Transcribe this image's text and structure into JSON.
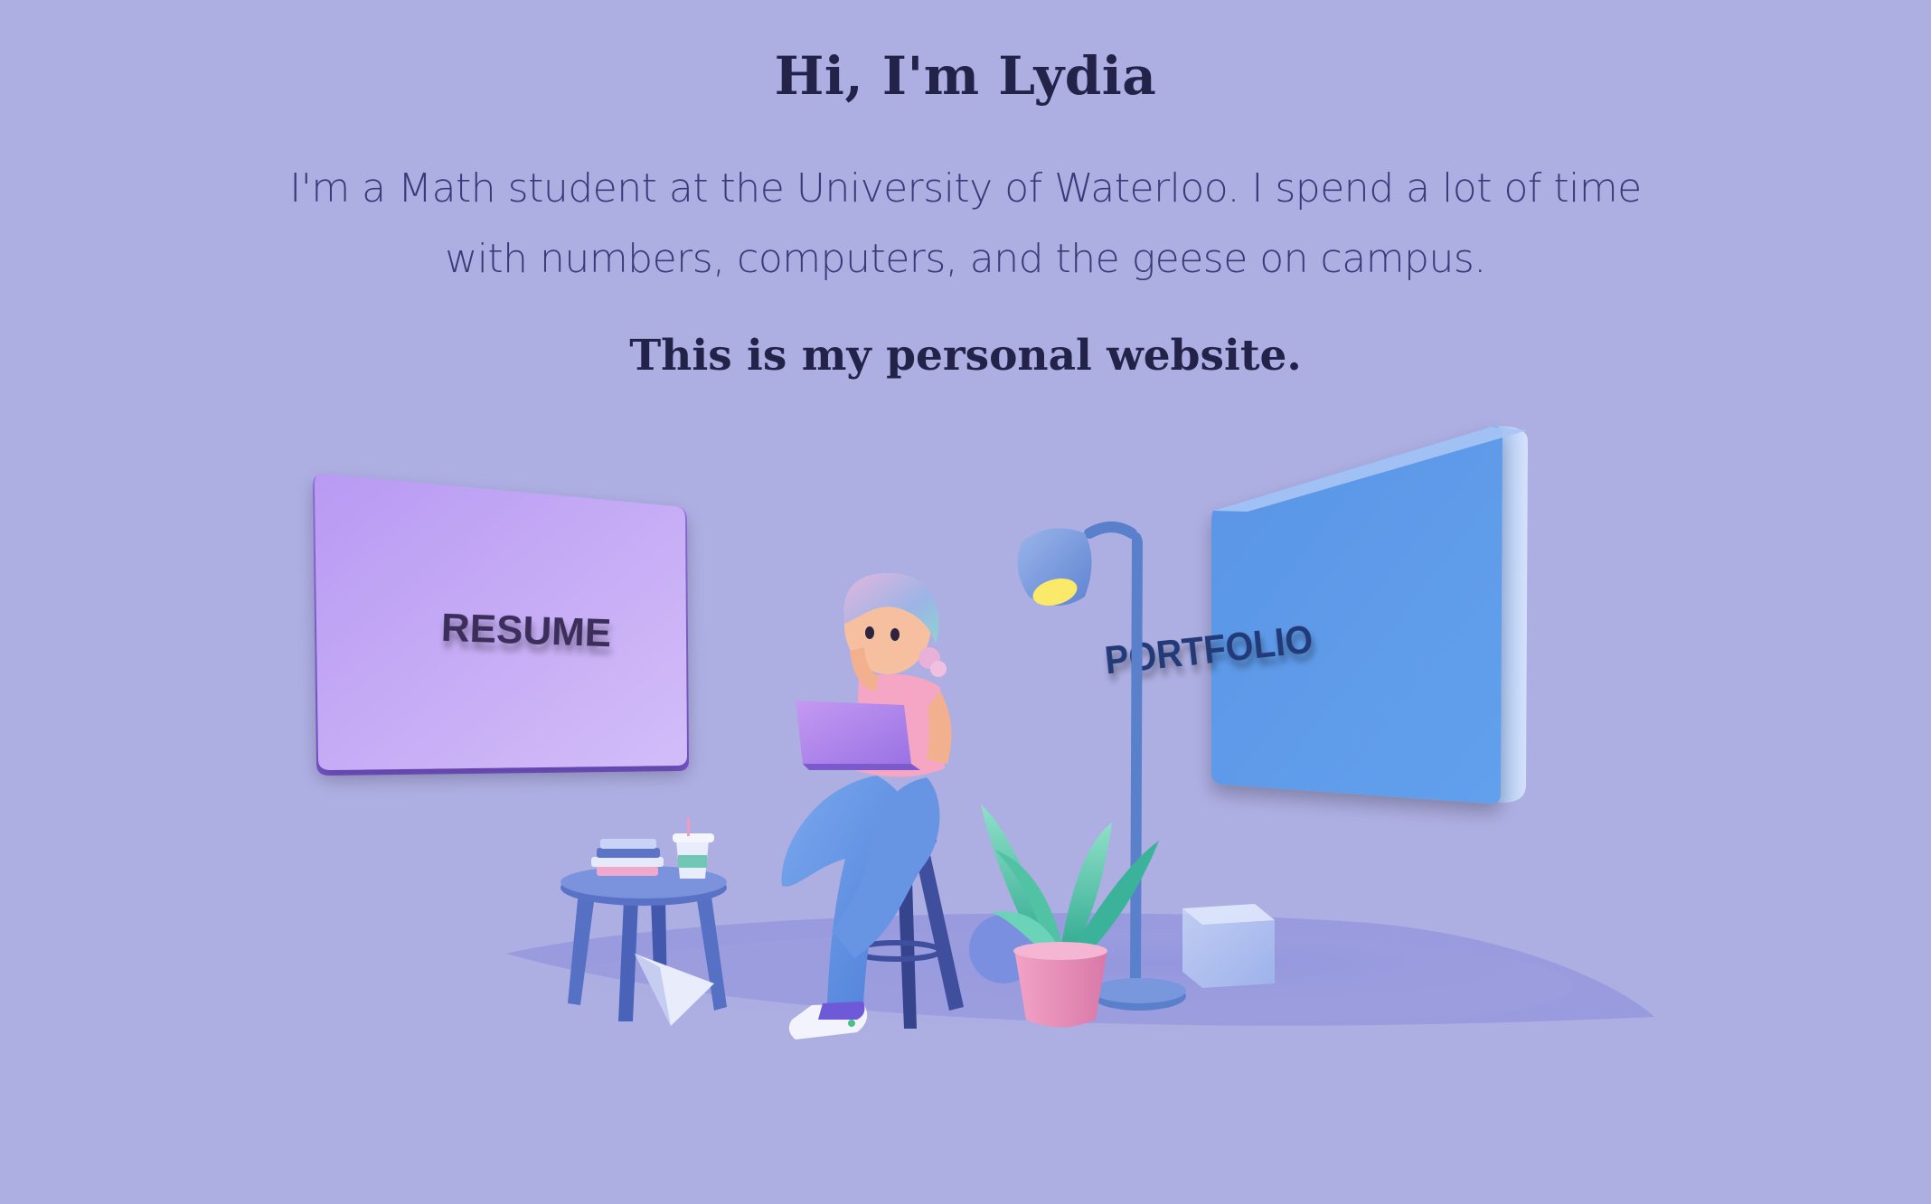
{
  "hero": {
    "title": "Hi, I'm Lydia",
    "intro": "I'm a Math student at the University of Waterloo. I spend a lot of time with numbers, computers, and the geese on campus.",
    "tagline": "This is my personal website."
  },
  "cards": {
    "resume_label": "RESUME",
    "portfolio_label": "PORTFOLIO"
  },
  "colors": {
    "background": "#adaee2",
    "text_dark": "#23234a",
    "text_body": "#3a3a7a",
    "resume_card": "#c4a4f5",
    "portfolio_card": "#5e9be8"
  }
}
